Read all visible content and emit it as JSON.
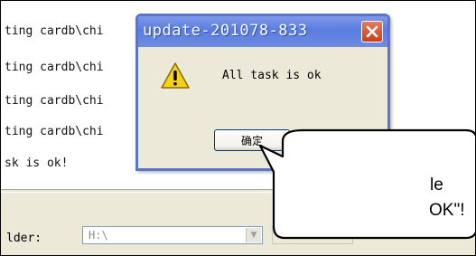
{
  "log": {
    "lines": [
      "ting cardb\\chi",
      "ting cardb\\chi",
      "ting cardb\\chi",
      "ting cardb\\chi",
      "sk is ok!"
    ]
  },
  "form": {
    "folder_label": "lder:",
    "folder_value": "H:\\"
  },
  "dialog": {
    "title": "update-201078-833",
    "message": "All task is ok",
    "ok_label": "确定",
    "icon": "warning-icon",
    "close_icon": "close-icon"
  },
  "callout": {
    "line1": "le",
    "line2": "OK\"!"
  },
  "colors": {
    "titlebar": "#5a7ce0",
    "close_button": "#c9401e",
    "dialog_border": "#5b74c9",
    "window_bg": "#ece9d8"
  }
}
